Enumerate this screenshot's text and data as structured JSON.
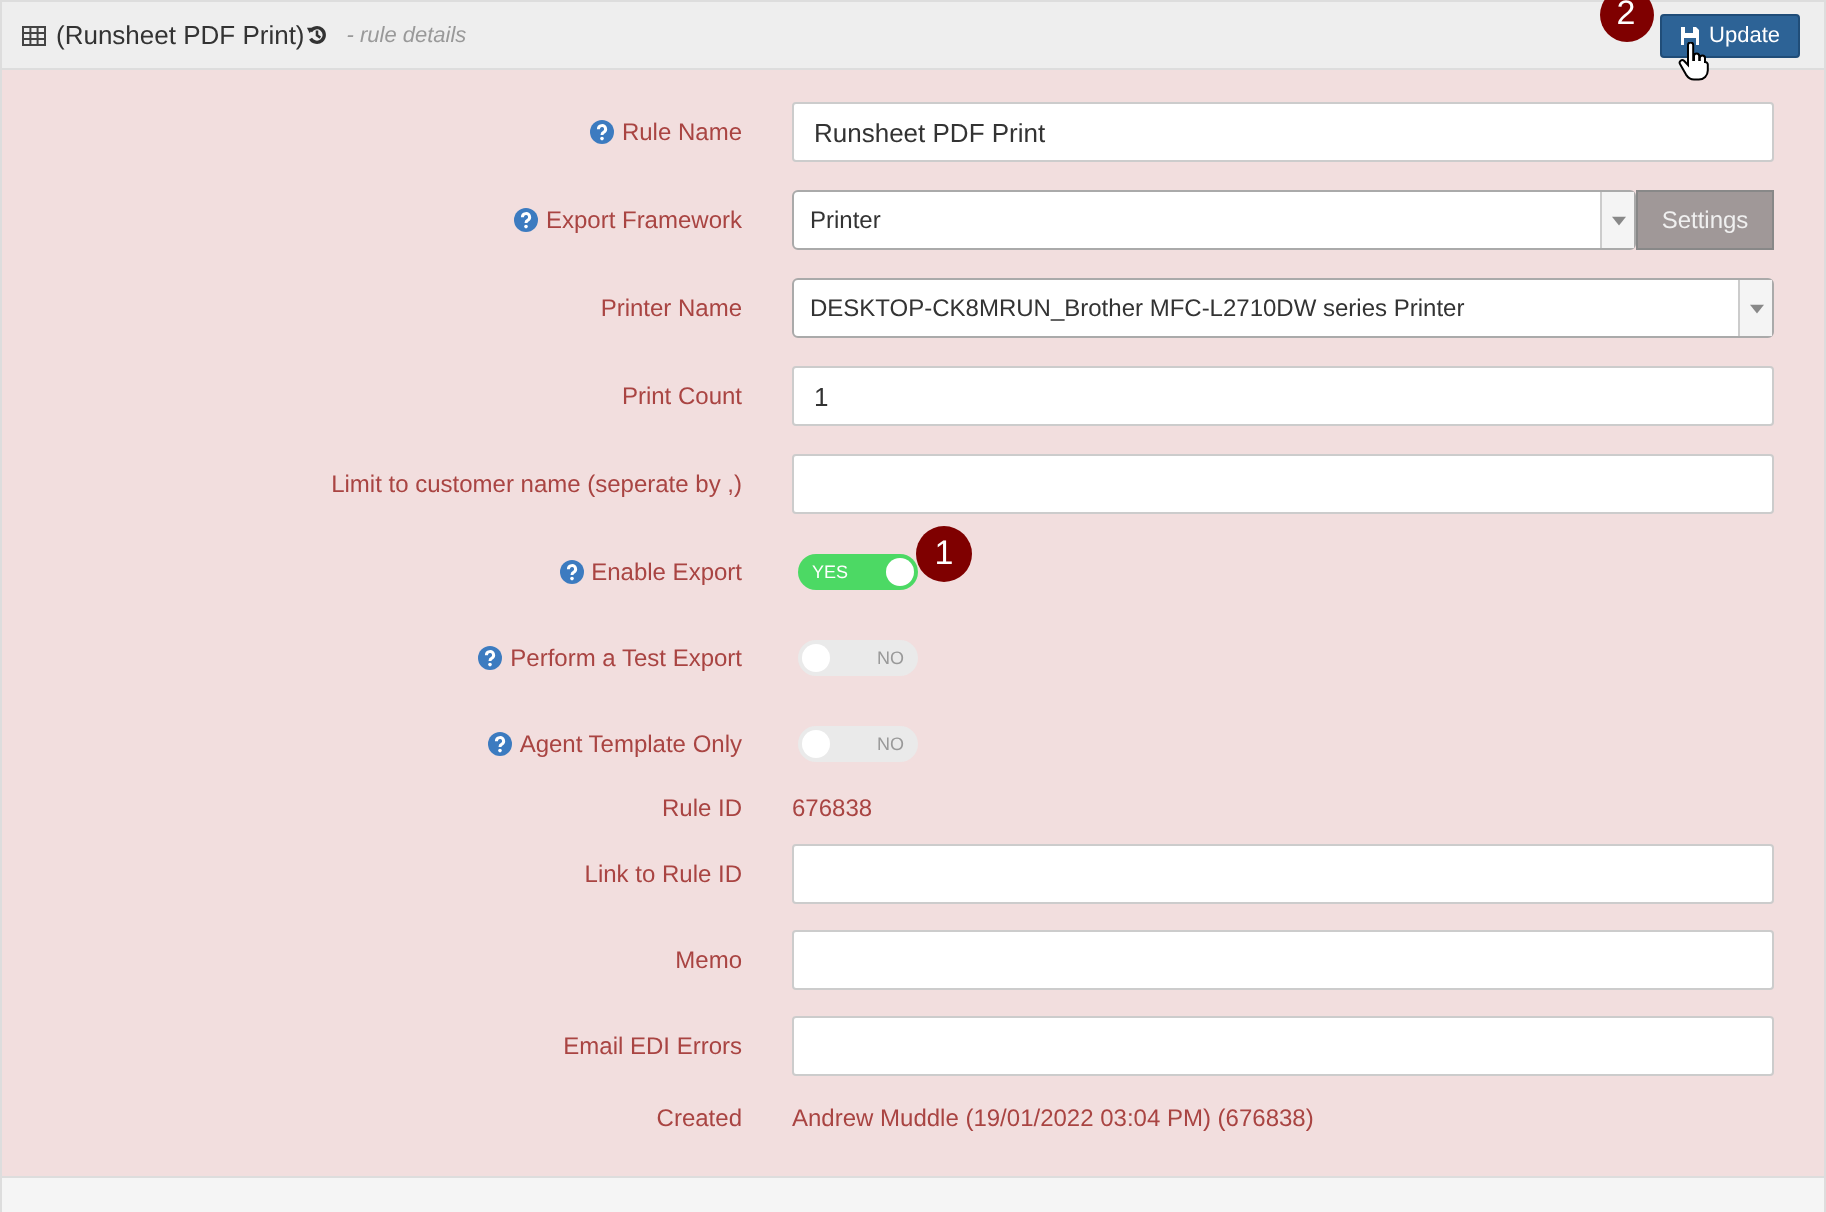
{
  "header": {
    "title": "(Runsheet PDF Print)",
    "subtitle": "- rule details",
    "update_button": "Update",
    "badge": "2"
  },
  "fields": [
    {
      "kind": "input",
      "label": "Rule Name",
      "help": true,
      "value": "Runsheet PDF Print"
    },
    {
      "kind": "select",
      "label": "Export Framework",
      "help": true,
      "value": "Printer",
      "button": "Settings"
    },
    {
      "kind": "select",
      "label": "Printer Name",
      "help": false,
      "value": "DESKTOP-CK8MRUN_Brother MFC-L2710DW series Printer"
    },
    {
      "kind": "input",
      "label": "Print Count",
      "help": false,
      "value": "1"
    },
    {
      "kind": "input",
      "label": "Limit to customer name (seperate by ,)",
      "help": false
    },
    {
      "kind": "toggle",
      "label": "Enable Export",
      "help": true,
      "on": true,
      "text": "YES",
      "badge": "1"
    },
    {
      "kind": "toggle",
      "label": "Perform a Test Export",
      "help": true,
      "on": false,
      "text": "NO"
    },
    {
      "kind": "toggle",
      "label": "Agent Template Only",
      "help": true,
      "on": false,
      "text": "NO"
    },
    {
      "kind": "static",
      "label": "Rule ID",
      "help": false,
      "value": "676838"
    },
    {
      "kind": "input",
      "label": "Link to Rule ID",
      "help": false
    },
    {
      "kind": "input",
      "label": "Memo",
      "help": false
    },
    {
      "kind": "input",
      "label": "Email EDI Errors",
      "help": false
    },
    {
      "kind": "static",
      "label": "Created",
      "help": false,
      "value": "Andrew Muddle (19/01/2022 03:04 PM) (676838)"
    }
  ]
}
